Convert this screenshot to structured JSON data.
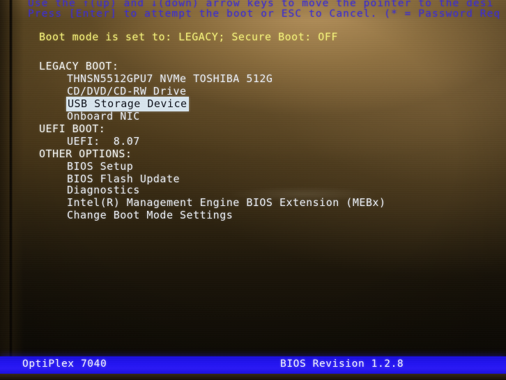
{
  "colors": {
    "hint_text": "#3d2fd0",
    "boot_mode_text": "#f2ef7a",
    "heading_text": "#f3f4f0",
    "item_text": "#e9ecf2",
    "selection_background": "#d9e6ef",
    "selection_text": "#10131c",
    "status_bar_background": "#2314f2",
    "status_bar_text": "#f2f3ff",
    "screen_background": "#2a1d0c"
  },
  "hints": {
    "line1": "Use the ↑(up) and ↓(down) arrow keys to move the pointer to the desi",
    "line2": "Press [Enter] to attempt the boot or ESC to Cancel. (* = Password Req"
  },
  "boot_mode": {
    "text": "Boot mode is set to: LEGACY; Secure Boot: OFF"
  },
  "groups": [
    {
      "heading": "LEGACY BOOT:",
      "items": [
        {
          "label": "THNSN5512GPU7 NVMe TOSHIBA 512G",
          "selected": false
        },
        {
          "label": "CD/DVD/CD-RW Drive",
          "selected": false
        },
        {
          "label": "USB Storage Device",
          "selected": true
        },
        {
          "label": "Onboard NIC",
          "selected": false
        }
      ]
    },
    {
      "heading": "UEFI BOOT:",
      "items": [
        {
          "label": "UEFI:  8.07",
          "selected": false
        }
      ]
    },
    {
      "heading": "OTHER OPTIONS:",
      "items": [
        {
          "label": "BIOS Setup",
          "selected": false
        },
        {
          "label": "BIOS Flash Update",
          "selected": false
        },
        {
          "label": "Diagnostics",
          "selected": false
        },
        {
          "label": "Intel(R) Management Engine BIOS Extension (MEBx)",
          "selected": false
        },
        {
          "label": "Change Boot Mode Settings",
          "selected": false
        }
      ]
    }
  ],
  "status_bar": {
    "model": "OptiPlex 7040",
    "bios_revision": "BIOS Revision 1.2.8"
  }
}
